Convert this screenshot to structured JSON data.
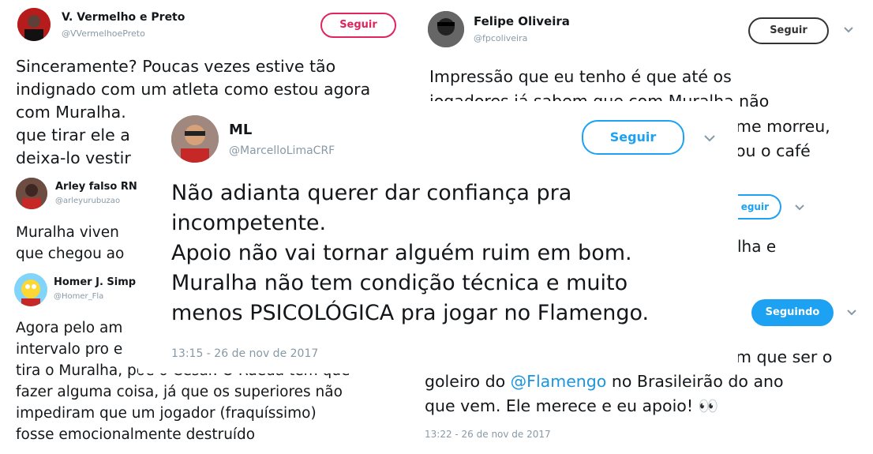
{
  "tweet1": {
    "name": "V. Vermelho e Preto",
    "handle": "@VVermelhoePreto",
    "button": "Seguir",
    "lines": [
      "Sinceramente? Poucas vezes estive tão",
      "indignado com um atleta como estou agora",
      "com Muralha.",
      "que tirar ele a",
      "deixa-lo vestir"
    ]
  },
  "tweet2": {
    "name": "Felipe Oliveira",
    "handle": "@fpcoliveira",
    "button": "Seguir",
    "lines": [
      "Impressão que eu tenho é que até os",
      "jogadores já sabem que com Muralha não",
      "me morreu,",
      "ou o café"
    ]
  },
  "tweet3": {
    "name": "Arley falso RN",
    "handle": "@arleyurubuzao",
    "lines": [
      "Muralha viven",
      "que chegou ao"
    ]
  },
  "tweet4": {
    "name": "Homer J. Simp",
    "handle": "@Homer_Fla",
    "lines": [
      "Agora pelo am",
      "intervalo pro e",
      "tira o Muralha, põe o César. O Rueda tem que",
      "fazer alguma coisa, já que os superiores não",
      "impediram que um jogador (fraquíssimo)",
      "fosse emocionalmente destruído"
    ]
  },
  "tweet5": {
    "button": "eguir",
    "lines": [
      "lha e"
    ]
  },
  "tweet6": {
    "button": "Seguindo",
    "line_a": "m que ser o",
    "line_b_pre": "goleiro do ",
    "mention": "@Flamengo",
    "line_b_post": " no Brasileirão do ano",
    "line_c": "que vem. Ele merece e eu apoio! 👀",
    "timestamp": "13:22 - 26 de nov de 2017"
  },
  "main": {
    "name": "ML",
    "handle": "@MarcelloLimaCRF",
    "button": "Seguir",
    "lines": [
      "Não adianta querer dar confiança pra",
      "incompetente.",
      "Apoio não vai tornar alguém ruim em bom.",
      "Muralha não tem condição técnica e muito",
      "menos PSICOLÓGICA pra jogar no Flamengo."
    ],
    "timestamp": "13:15 - 26 de nov de 2017"
  },
  "colors": {
    "link": "#1b95e0",
    "follow_blue": "#1da1f2",
    "follow_red": "#e0245e",
    "muted": "#8899a6"
  },
  "icons": [
    "chevron-down-icon"
  ]
}
